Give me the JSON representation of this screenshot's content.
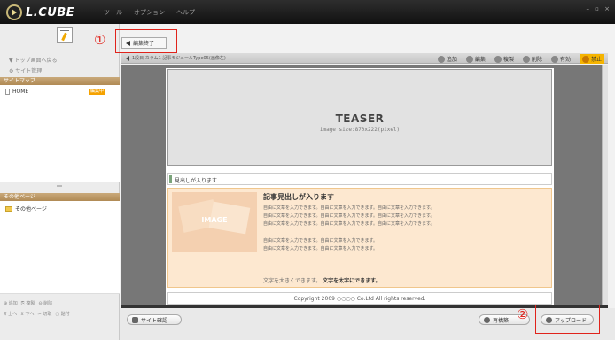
{
  "app": {
    "brand": "L.CUBE",
    "menu": [
      "ツール",
      "オプション",
      "ヘルプ"
    ],
    "window_controls": "– ▫ ×"
  },
  "left": {
    "nav": [
      "トップ画面へ戻る",
      "サイト管理"
    ],
    "sitemap_heading": "サイトマップ",
    "sitemap_items": [
      {
        "label": "HOME",
        "badge": "編集中"
      }
    ],
    "other_heading": "その他ページ",
    "other_items": [
      {
        "label": "その他ページ"
      }
    ],
    "buttons_row1": [
      "追加",
      "複製",
      "削除"
    ],
    "buttons_row2": [
      "上へ",
      "下へ",
      "切取",
      "貼付"
    ]
  },
  "main": {
    "edit_end_label": "編集終了",
    "breadcrumb": "1段目 カラム1 記事モジュールType05(画像左)",
    "toolbar": [
      {
        "label": "追加",
        "icon": "plus-circle-icon"
      },
      {
        "label": "編集",
        "icon": "edit-icon"
      },
      {
        "label": "複製",
        "icon": "copy-icon"
      },
      {
        "label": "削除",
        "icon": "minus-circle-icon"
      },
      {
        "label": "有効",
        "icon": "check-icon"
      },
      {
        "label": "禁止",
        "icon": "forbid-icon"
      }
    ]
  },
  "page": {
    "teaser_title": "TEASER",
    "teaser_size": "image size:870x222(pixel)",
    "heading_text": "見出しが入ります",
    "article_title": "記事見出しが入ります",
    "image_label": "IMAGE",
    "body_lines": [
      "自由に文章を入力できます。自由に文章を入力できます。自由に文章を入力できます。",
      "自由に文章を入力できます。自由に文章を入力できます。自由に文章を入力できます。",
      "自由に文章を入力できます。自由に文章を入力できます。自由に文章を入力できます。",
      "自由に文章を入力できます。自由に文章を入力できます。",
      "自由に文章を入力できます。自由に文章を入力できます。"
    ],
    "big_text_prefix": "文字を大きくできます。",
    "bold_text": "文字を太字にできます。",
    "footer": "Copyright 2009 ○○○○ Co.Ltd All rights reserved."
  },
  "bottom": {
    "site_check": "サイト確認",
    "reload": "再構築",
    "upload": "アップロード"
  },
  "annotations": {
    "one": "①",
    "two": "②"
  },
  "colors": {
    "accent": "#f5a200",
    "highlight": "#e0231b",
    "article_bg": "#fde8d0"
  }
}
